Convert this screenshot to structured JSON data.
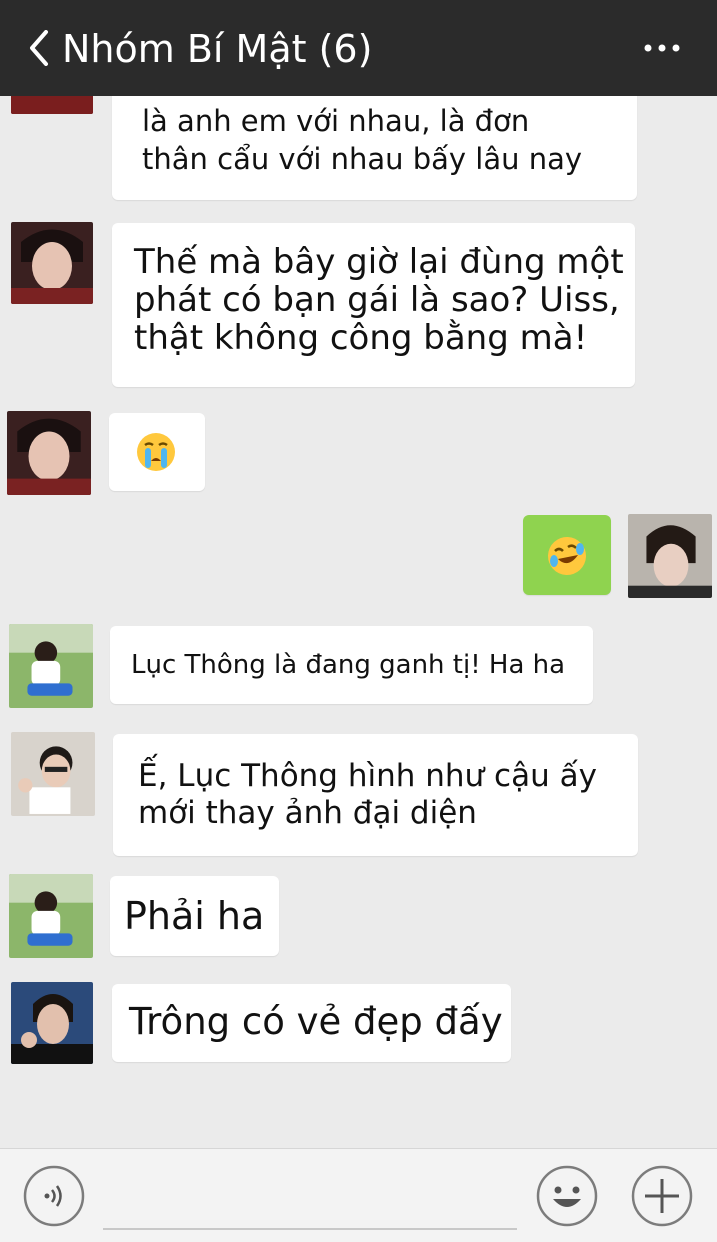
{
  "header": {
    "title": "Nhóm Bí Mật (6)",
    "back_icon": "chevron-left-icon",
    "menu_icon": "more-dots-icon"
  },
  "messages": [
    {
      "side": "left",
      "sender_avatar": "avatar-boy-red",
      "text": "là anh em với nhau, là đơn\nthân cẩu với nhau bấy lâu nay"
    },
    {
      "side": "left",
      "sender_avatar": "avatar-boy-red",
      "text": "Thế mà bây giờ lại đùng một\nphát có bạn gái là sao? Uiss,\nthật không công bằng mà!"
    },
    {
      "side": "left",
      "sender_avatar": "avatar-boy-red",
      "emoji": "😭"
    },
    {
      "side": "right",
      "sender_avatar": "avatar-boy-dark",
      "emoji": "😂"
    },
    {
      "side": "left",
      "sender_avatar": "avatar-boy-field",
      "text": "Lục Thông là đang ganh tị! Ha ha"
    },
    {
      "side": "left",
      "sender_avatar": "avatar-boy-glasses",
      "text": "Ế, Lục Thông hình như cậu ấy\nmới thay ảnh đại diện"
    },
    {
      "side": "left",
      "sender_avatar": "avatar-boy-field",
      "text": "Phải ha"
    },
    {
      "side": "left",
      "sender_avatar": "avatar-boy-jacket",
      "text": "Trông có vẻ đẹp đấy"
    }
  ],
  "input_bar": {
    "voice_icon": "voice-icon",
    "emoji_icon": "smiley-icon",
    "plus_icon": "plus-icon"
  },
  "colors": {
    "header_bg": "#2b2b2b",
    "chat_bg": "#ebebeb",
    "bubble_left": "#ffffff",
    "bubble_right": "#8fd34f"
  }
}
